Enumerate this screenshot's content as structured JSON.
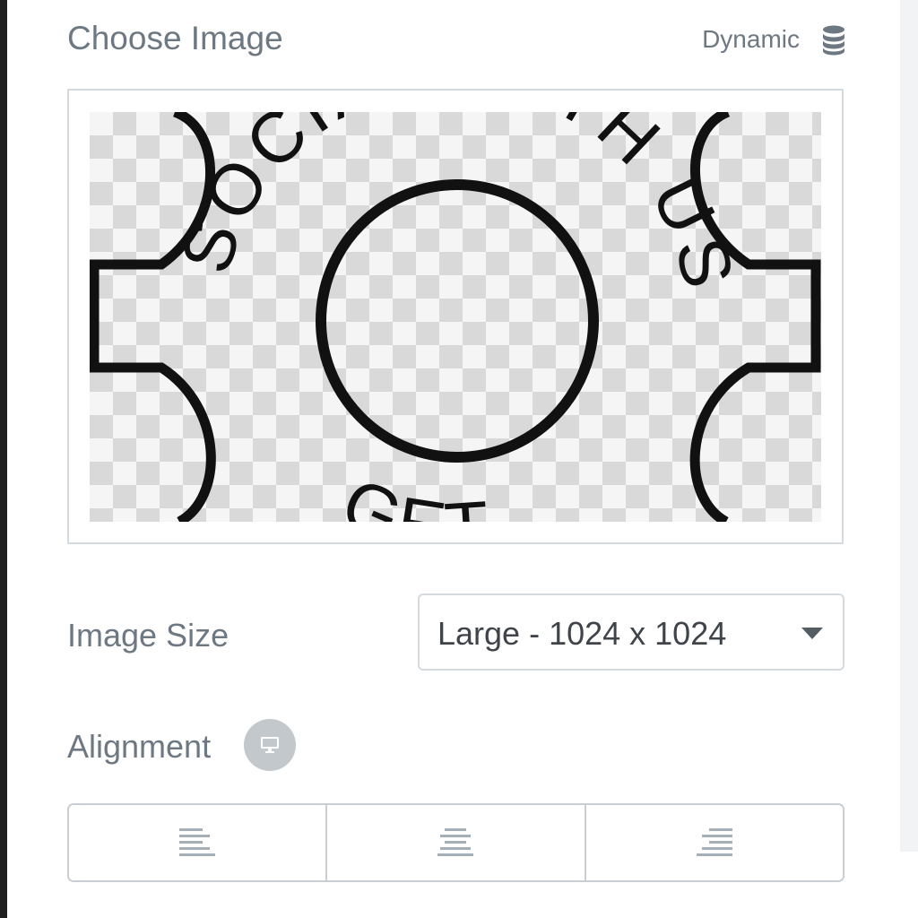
{
  "header": {
    "title": "Choose Image",
    "dynamic_label": "Dynamic",
    "dynamic_icon": "database-icon"
  },
  "image_preview": {
    "text_ring": "SOCIAL WITH US",
    "text_bottom": "GET"
  },
  "image_size": {
    "label": "Image Size",
    "selected": "Large - 1024 x 1024"
  },
  "alignment": {
    "label": "Alignment",
    "device_icon": "desktop-icon",
    "options": [
      {
        "icon": "align-left-icon"
      },
      {
        "icon": "align-center-icon"
      },
      {
        "icon": "align-right-icon"
      }
    ]
  },
  "colors": {
    "text_muted": "#6d7882",
    "border": "#d5dadf",
    "badge": "#c3c8cd"
  }
}
